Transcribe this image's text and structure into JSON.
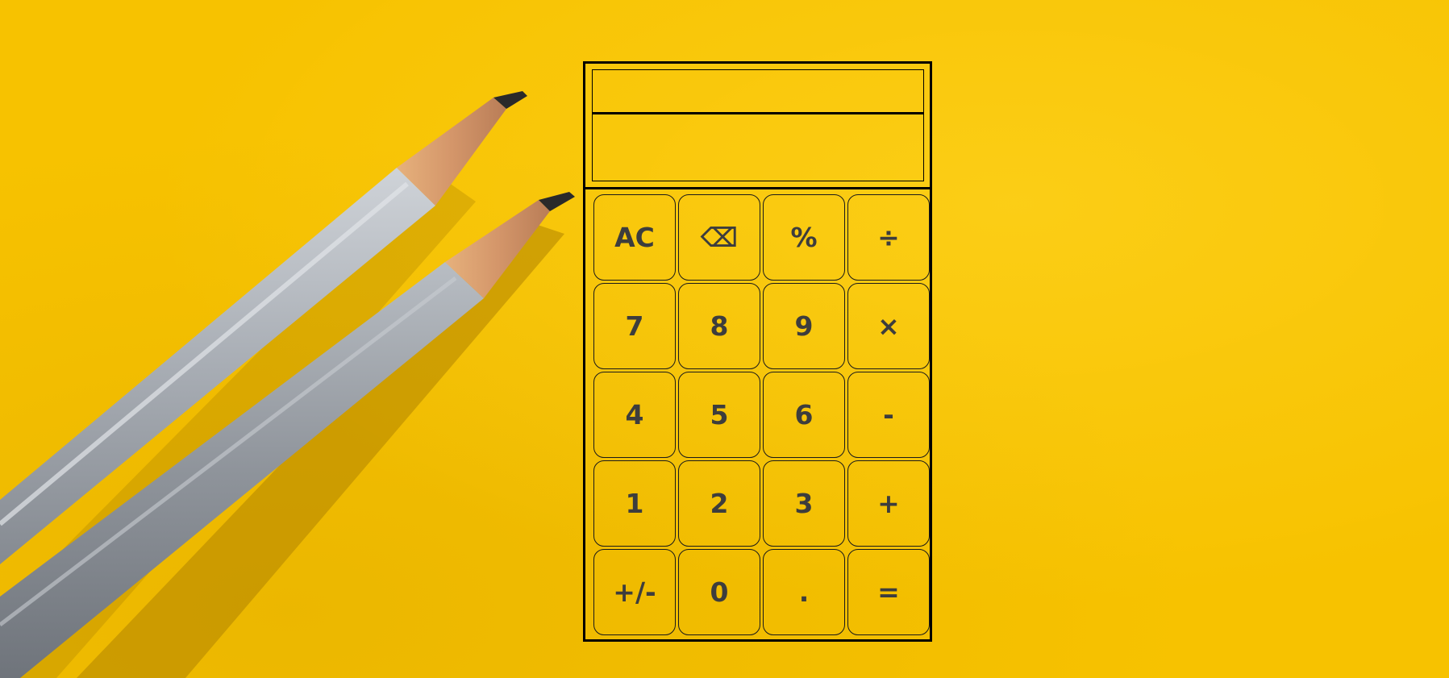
{
  "display": {
    "previous_operand": "",
    "current_operand": ""
  },
  "keys": [
    {
      "label": "AC",
      "name": "all-clear-button"
    },
    {
      "label": "⌫",
      "name": "backspace-button"
    },
    {
      "label": "%",
      "name": "percent-button"
    },
    {
      "label": "÷",
      "name": "divide-button"
    },
    {
      "label": "7",
      "name": "digit-7-button"
    },
    {
      "label": "8",
      "name": "digit-8-button"
    },
    {
      "label": "9",
      "name": "digit-9-button"
    },
    {
      "label": "×",
      "name": "multiply-button"
    },
    {
      "label": "4",
      "name": "digit-4-button"
    },
    {
      "label": "5",
      "name": "digit-5-button"
    },
    {
      "label": "6",
      "name": "digit-6-button"
    },
    {
      "label": "-",
      "name": "subtract-button"
    },
    {
      "label": "1",
      "name": "digit-1-button"
    },
    {
      "label": "2",
      "name": "digit-2-button"
    },
    {
      "label": "3",
      "name": "digit-3-button"
    },
    {
      "label": "+",
      "name": "add-button"
    },
    {
      "label": "+/-",
      "name": "toggle-sign-button"
    },
    {
      "label": "0",
      "name": "digit-0-button"
    },
    {
      "label": ".",
      "name": "decimal-point-button"
    },
    {
      "label": "=",
      "name": "equals-button"
    }
  ],
  "colors": {
    "background": "#f7c200",
    "key_text": "#3d3d3d",
    "border": "#000000"
  }
}
